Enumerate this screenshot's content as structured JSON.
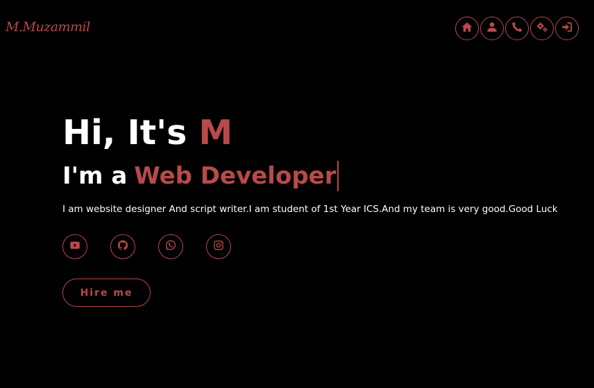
{
  "brand": {
    "logo_text": "M.Muzammil",
    "accent_color": "#b94a4a",
    "background_color": "#000000",
    "text_color": "#ffffff"
  },
  "nav": {
    "items": [
      {
        "icon": "home-icon"
      },
      {
        "icon": "user-icon"
      },
      {
        "icon": "phone-icon"
      },
      {
        "icon": "settings-icon"
      },
      {
        "icon": "sign-in-icon"
      }
    ]
  },
  "hero": {
    "greeting_prefix": "Hi, It's",
    "greeting_highlight": "M",
    "subtitle_prefix": "I'm a",
    "subtitle_role": "Web Developer",
    "bio": "I am website designer And script writer.I am student of 1st Year ICS.And my team is very good.Good Luck"
  },
  "socials": {
    "items": [
      {
        "icon": "youtube-icon"
      },
      {
        "icon": "github-icon"
      },
      {
        "icon": "whatsapp-icon"
      },
      {
        "icon": "instagram-icon"
      }
    ]
  },
  "cta": {
    "hire_label": "Hire me"
  }
}
